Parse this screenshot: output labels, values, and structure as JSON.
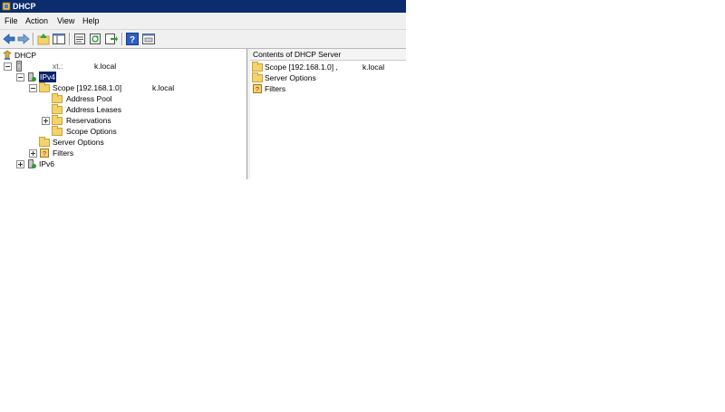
{
  "window": {
    "title": "DHCP",
    "menu": [
      "File",
      "Action",
      "View",
      "Help"
    ],
    "toolbar": [
      "back-icon",
      "forward-icon",
      "up-icon",
      "show-hide-tree-icon",
      "properties-icon",
      "refresh-icon",
      "export-icon",
      "help-icon",
      "mmc-icon"
    ]
  },
  "tree": {
    "root": "DHCP",
    "server_prefix": "",
    "server_partial": "xt.:",
    "server_suffix": "k.local",
    "ipv4": "IPv4",
    "scope_prefix": "Scope [192.168.1.0] ",
    "scope_suffix": "k.local",
    "address_pool": "Address Pool",
    "address_leases": "Address Leases",
    "reservations": "Reservations",
    "scope_options": "Scope Options",
    "server_options": "Server Options",
    "filters": "Filters",
    "ipv6": "IPv6"
  },
  "right_pane": {
    "header": "Contents of DHCP Server",
    "items": [
      {
        "prefix": "Scope [192.168.1.0] ,",
        "suffix": "k.local"
      },
      {
        "prefix": "Server Options",
        "suffix": ""
      },
      {
        "prefix": "Filters",
        "suffix": ""
      }
    ]
  },
  "colors": {
    "titlebar": "#0b2c6d",
    "selection": "#0a246a",
    "folder": "#f5d36b"
  }
}
